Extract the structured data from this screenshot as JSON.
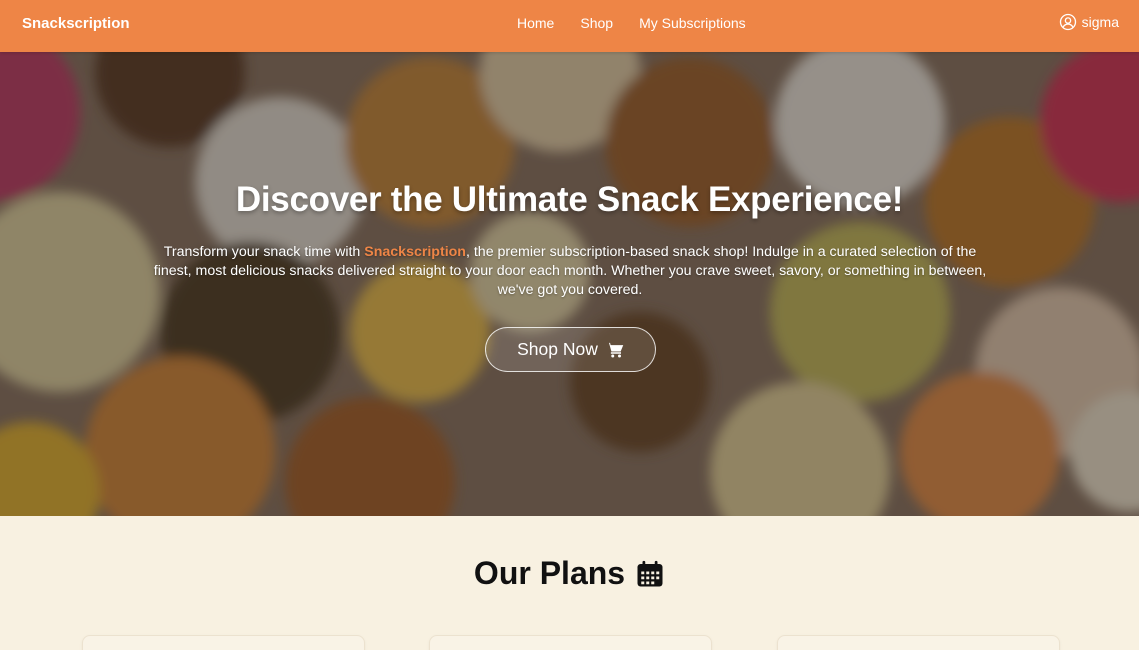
{
  "navbar": {
    "brand": "Snackscription",
    "links": [
      "Home",
      "Shop",
      "My Subscriptions"
    ],
    "user": "sigma",
    "user_icon": "user-circle-icon",
    "bg_color": "#ee8546"
  },
  "hero": {
    "title": "Discover the Ultimate Snack Experience!",
    "text_before": "Transform your snack time with ",
    "highlight": "Snackscription",
    "text_after": ", the premier subscription-based snack shop! Indulge in a curated selection of the finest, most delicious snacks delivered straight to your door each month. Whether you crave sweet, savory, or something in between, we've got you covered.",
    "button_label": "Shop Now",
    "button_icon": "cart-icon",
    "highlight_color": "#ee8546"
  },
  "plans": {
    "title": "Our Plans",
    "icon": "calendar-icon"
  }
}
